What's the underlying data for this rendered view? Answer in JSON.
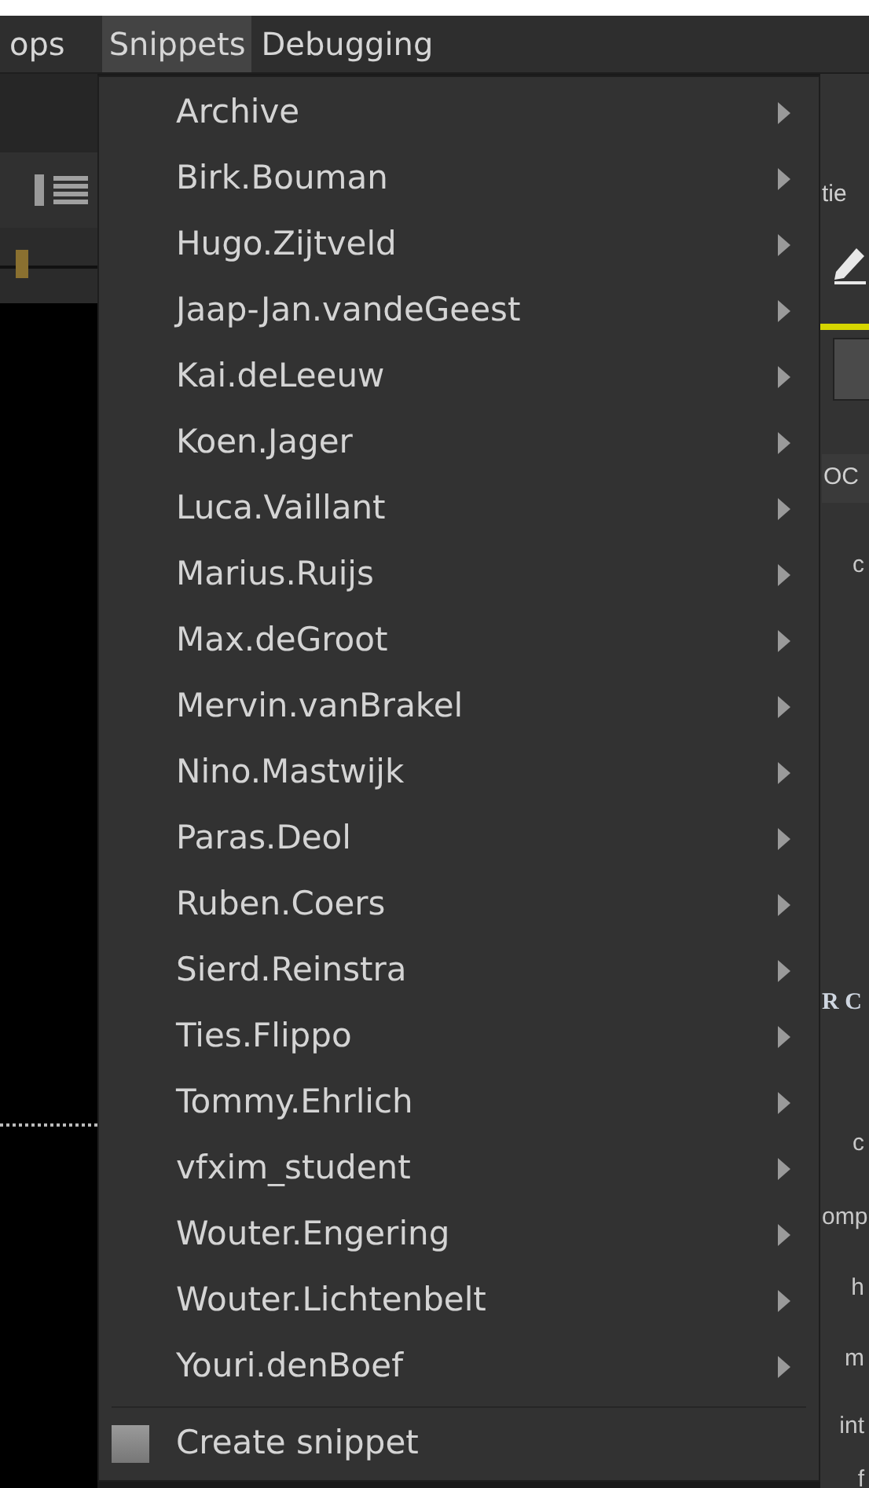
{
  "menubar": [
    {
      "label": "ops",
      "selected": false
    },
    {
      "label": "Snippets",
      "selected": true
    },
    {
      "label": "Debugging",
      "selected": false
    }
  ],
  "menu": {
    "items": [
      {
        "label": "Archive",
        "submenu": true
      },
      {
        "label": "Birk.Bouman",
        "submenu": true
      },
      {
        "label": "Hugo.Zijtveld",
        "submenu": true
      },
      {
        "label": "Jaap-Jan.vandeGeest",
        "submenu": true
      },
      {
        "label": "Kai.deLeeuw",
        "submenu": true
      },
      {
        "label": "Koen.Jager",
        "submenu": true
      },
      {
        "label": "Luca.Vaillant",
        "submenu": true
      },
      {
        "label": "Marius.Ruijs",
        "submenu": true
      },
      {
        "label": "Max.deGroot",
        "submenu": true
      },
      {
        "label": "Mervin.vanBrakel",
        "submenu": true
      },
      {
        "label": "Nino.Mastwijk",
        "submenu": true
      },
      {
        "label": "Paras.Deol",
        "submenu": true
      },
      {
        "label": "Ruben.Coers",
        "submenu": true
      },
      {
        "label": "Sierd.Reinstra",
        "submenu": true
      },
      {
        "label": "Ties.Flippo",
        "submenu": true
      },
      {
        "label": "Tommy.Ehrlich",
        "submenu": true
      },
      {
        "label": "vfxim_student",
        "submenu": true
      },
      {
        "label": "Wouter.Engering",
        "submenu": true
      },
      {
        "label": "Wouter.Lichtenbelt",
        "submenu": true
      },
      {
        "label": "Youri.denBoef",
        "submenu": true
      }
    ],
    "action": {
      "label": "Create snippet"
    }
  },
  "right_panel": {
    "texts": [
      {
        "text": "tie",
        "kind": "tab"
      },
      {
        "text": "OC",
        "kind": "header"
      },
      {
        "text": "c",
        "kind": "label"
      },
      {
        "text": "R C",
        "kind": "heading"
      },
      {
        "text": "c",
        "kind": "label"
      },
      {
        "text": "omp",
        "kind": "label"
      },
      {
        "text": "h",
        "kind": "label"
      },
      {
        "text": "m",
        "kind": "label"
      },
      {
        "text": "int",
        "kind": "label"
      },
      {
        "text": "f",
        "kind": "label"
      }
    ]
  }
}
